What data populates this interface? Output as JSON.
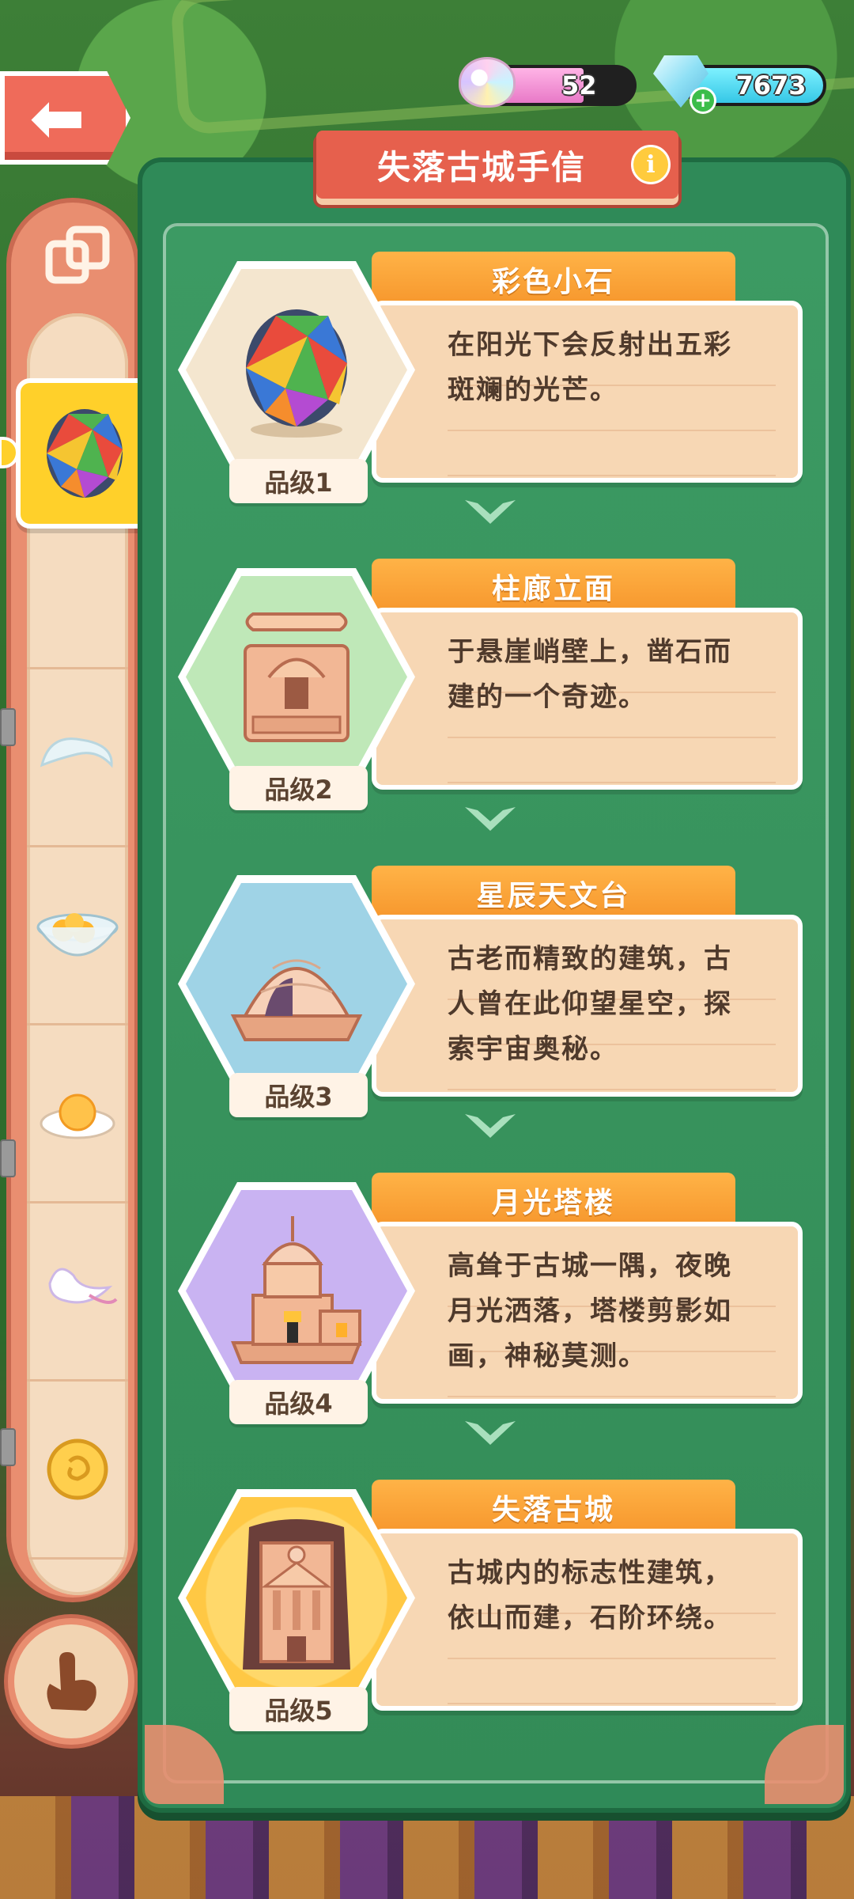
{
  "currency": {
    "cotton_candy": {
      "value": "52",
      "icon": "cotton-candy-icon",
      "fill_fraction": 0.53
    },
    "gems": {
      "value": "7673",
      "icon": "gem-icon",
      "add_icon": "plus-icon"
    }
  },
  "back": {
    "icon": "back-arrow-icon",
    "glyph": "⬅"
  },
  "panel": {
    "title": "失落古城手信",
    "info_glyph": "i"
  },
  "sidebar": {
    "top_icon": "switch-view-icon",
    "items": [
      {
        "name": "stained-glass-stone",
        "selected": false
      },
      {
        "name": "colorful-stone",
        "selected": true
      },
      {
        "name": "cloud-swirl",
        "selected": false
      },
      {
        "name": "egg-bowl",
        "selected": false
      },
      {
        "name": "fried-egg-plate",
        "selected": false
      },
      {
        "name": "white-bird",
        "selected": false
      },
      {
        "name": "golden-coin",
        "selected": false
      },
      {
        "name": "chocolate-pile",
        "selected": false
      }
    ],
    "hand_icon": "hand-pointer-icon"
  },
  "items": [
    {
      "name": "彩色小石",
      "description_lines": [
        "在阳光下会反射出五彩",
        "斑斓的光芒。"
      ],
      "grade": "品级1",
      "hex_color": "#f4e6cf",
      "icon": "colorful-stone-icon"
    },
    {
      "name": "柱廊立面",
      "description_lines": [
        "于悬崖峭壁上，凿石而",
        "建的一个奇迹。"
      ],
      "grade": "品级2",
      "hex_color": "#bfe8b8",
      "icon": "colonnade-facade-icon"
    },
    {
      "name": "星辰天文台",
      "description_lines": [
        "古老而精致的建筑，古",
        "人曾在此仰望星空，探",
        "索宇宙奥秘。"
      ],
      "grade": "品级3",
      "hex_color": "#9fd3e6",
      "icon": "observatory-icon"
    },
    {
      "name": "月光塔楼",
      "description_lines": [
        "高耸于古城一隅，夜晚",
        "月光洒落，塔楼剪影如",
        "画，神秘莫测。"
      ],
      "grade": "品级4",
      "hex_color": "#c9b3f2",
      "icon": "moonlight-tower-icon"
    },
    {
      "name": "失落古城",
      "description_lines": [
        "古城内的标志性建筑，",
        "依山而建，石阶环绕。"
      ],
      "grade": "品级5",
      "hex_color": "#ffd86a",
      "icon": "lost-city-icon"
    }
  ]
}
